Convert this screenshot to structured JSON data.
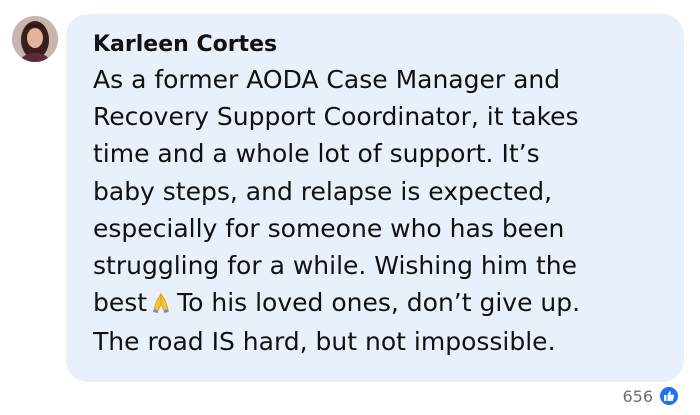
{
  "comment": {
    "author": "Karleen Cortes",
    "lines": [
      "As a former AODA Case Manager and",
      "Recovery Support Coordinator, it takes",
      "time and a whole lot of support. It’s",
      "baby steps, and relapse is expected,",
      "especially for someone who has been",
      "struggling for a while. Wishing him the"
    ],
    "line7_before_emoji": "best",
    "emoji": "folded-hands-icon",
    "line7_after_emoji": "To his loved ones, don’t give up.",
    "line8": "The road IS hard, but not impossible."
  },
  "reactions": {
    "count": "656",
    "icon": "thumbs-up-icon",
    "accent_color": "#1f73f2"
  },
  "colors": {
    "bubble_background": "#e8f0fb",
    "text": "#111111",
    "reaction_count_text": "#66707a"
  }
}
